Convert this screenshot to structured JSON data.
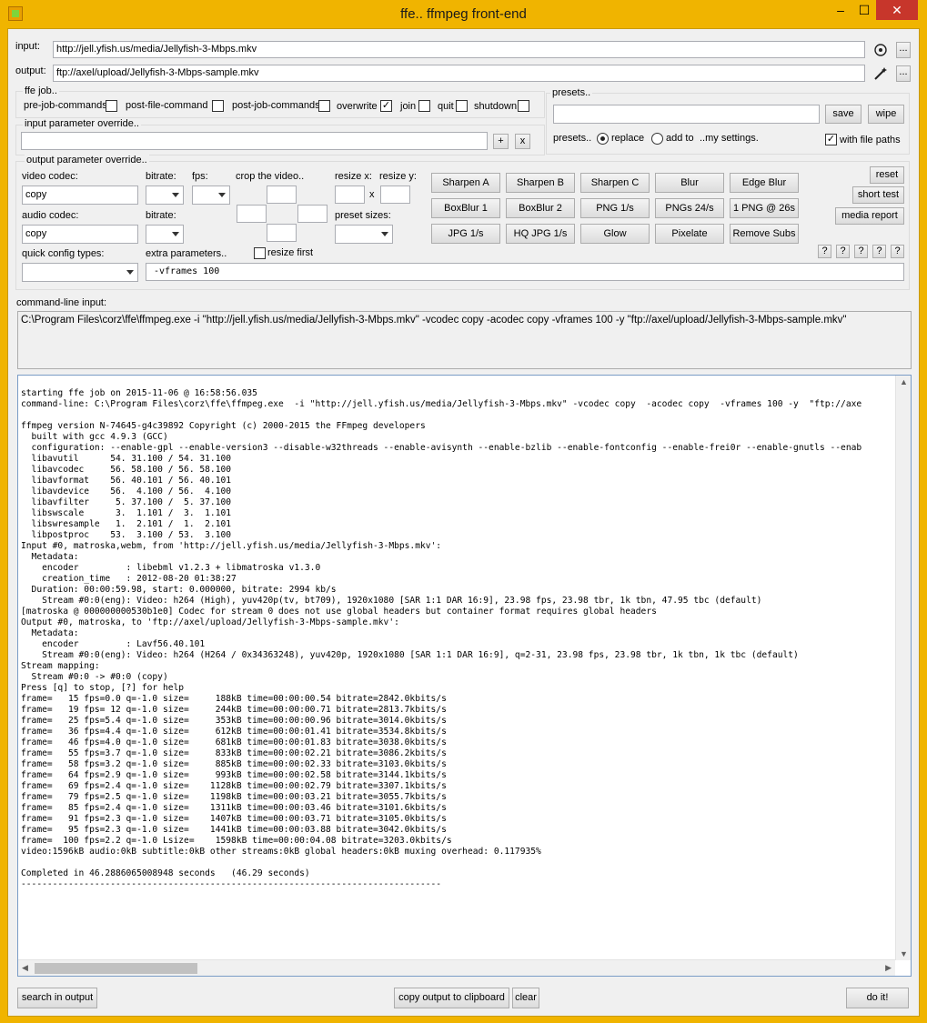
{
  "window": {
    "title": "ffe.. ffmpeg front-end",
    "minimize": "–",
    "maximize": "☐",
    "close": "✕"
  },
  "io": {
    "input_label": "input:",
    "input_value": "http://jell.yfish.us/media/Jellyfish-3-Mbps.mkv",
    "output_label": "output:",
    "output_value": "ftp://axel/upload/Jellyfish-3-Mbps-sample.mkv",
    "browse_label": "...",
    "target_icon": "crosshair-icon",
    "wand_icon": "magic-wand-icon"
  },
  "job": {
    "title": "ffe job..",
    "pre_job": "pre-job-commands",
    "post_file": "post-file-command",
    "post_job": "post-job-commands",
    "overwrite": "overwrite",
    "overwrite_checked": true,
    "join": "join",
    "quit": "quit",
    "shutdown": "shutdown"
  },
  "input_override": {
    "title": "input parameter override..",
    "value": "",
    "add": "+",
    "clear": "x"
  },
  "presets": {
    "title": "presets..",
    "selected": "",
    "save": "save",
    "wipe": "wipe",
    "mode_label": "presets..",
    "replace": "replace",
    "add_to": "add to",
    "my_settings": "..my settings.",
    "with_file_paths": "with file paths",
    "with_file_paths_checked": true
  },
  "output_override": {
    "title": "output parameter override..",
    "video_codec_label": "video codec:",
    "video_codec": "copy",
    "bitrate_label": "bitrate:",
    "fps_label": "fps:",
    "crop_label": "crop the video..",
    "resize_x_label": "resize x:",
    "resize_y_label": "resize y:",
    "resize_sep": "x",
    "audio_codec_label": "audio codec:",
    "audio_codec": "copy",
    "audio_bitrate_label": "bitrate:",
    "preset_sizes_label": "preset sizes:",
    "quick_config_label": "quick config types:",
    "extra_params_label": "extra parameters..",
    "resize_first": "resize first",
    "extra_params": "-vframes 100"
  },
  "filters": {
    "row1": [
      "Sharpen A",
      "Sharpen B",
      "Sharpen C",
      "Blur",
      "Edge Blur"
    ],
    "row2": [
      "BoxBlur 1",
      "BoxBlur 2",
      "PNG 1/s",
      "PNGs 24/s",
      "1 PNG @ 26s"
    ],
    "row3": [
      "JPG 1/s",
      "HQ JPG 1/s",
      "Glow",
      "Pixelate",
      "Remove Subs"
    ]
  },
  "side": {
    "reset": "reset",
    "short_test": "short test",
    "media_report": "media report",
    "help": "?"
  },
  "cmd": {
    "label": "command-line input:",
    "value": "C:\\Program Files\\corz\\ffe\\ffmpeg.exe  -i \"http://jell.yfish.us/media/Jellyfish-3-Mbps.mkv\" -vcodec copy  -acodec copy  -vframes 100 -y  \"ftp://axel/upload/Jellyfish-3-Mbps-sample.mkv\""
  },
  "output_log": [
    "starting ffe job on 2015-11-06 @ 16:58:56.035",
    "command-line: C:\\Program Files\\corz\\ffe\\ffmpeg.exe  -i \"http://jell.yfish.us/media/Jellyfish-3-Mbps.mkv\" -vcodec copy  -acodec copy  -vframes 100 -y  \"ftp://axe",
    "",
    "ffmpeg version N-74645-g4c39892 Copyright (c) 2000-2015 the FFmpeg developers",
    "  built with gcc 4.9.3 (GCC)",
    "  configuration: --enable-gpl --enable-version3 --disable-w32threads --enable-avisynth --enable-bzlib --enable-fontconfig --enable-frei0r --enable-gnutls --enab",
    "  libavutil      54. 31.100 / 54. 31.100",
    "  libavcodec     56. 58.100 / 56. 58.100",
    "  libavformat    56. 40.101 / 56. 40.101",
    "  libavdevice    56.  4.100 / 56.  4.100",
    "  libavfilter     5. 37.100 /  5. 37.100",
    "  libswscale      3.  1.101 /  3.  1.101",
    "  libswresample   1.  2.101 /  1.  2.101",
    "  libpostproc    53.  3.100 / 53.  3.100",
    "Input #0, matroska,webm, from 'http://jell.yfish.us/media/Jellyfish-3-Mbps.mkv':",
    "  Metadata:",
    "    encoder         : libebml v1.2.3 + libmatroska v1.3.0",
    "    creation_time   : 2012-08-20 01:38:27",
    "  Duration: 00:00:59.98, start: 0.000000, bitrate: 2994 kb/s",
    "    Stream #0:0(eng): Video: h264 (High), yuv420p(tv, bt709), 1920x1080 [SAR 1:1 DAR 16:9], 23.98 fps, 23.98 tbr, 1k tbn, 47.95 tbc (default)",
    "[matroska @ 000000000530b1e0] Codec for stream 0 does not use global headers but container format requires global headers",
    "Output #0, matroska, to 'ftp://axel/upload/Jellyfish-3-Mbps-sample.mkv':",
    "  Metadata:",
    "    encoder         : Lavf56.40.101",
    "    Stream #0:0(eng): Video: h264 (H264 / 0x34363248), yuv420p, 1920x1080 [SAR 1:1 DAR 16:9], q=2-31, 23.98 fps, 23.98 tbr, 1k tbn, 1k tbc (default)",
    "Stream mapping:",
    "  Stream #0:0 -> #0:0 (copy)",
    "Press [q] to stop, [?] for help",
    "frame=   15 fps=0.0 q=-1.0 size=     188kB time=00:00:00.54 bitrate=2842.0kbits/s",
    "frame=   19 fps= 12 q=-1.0 size=     244kB time=00:00:00.71 bitrate=2813.7kbits/s",
    "frame=   25 fps=5.4 q=-1.0 size=     353kB time=00:00:00.96 bitrate=3014.0kbits/s",
    "frame=   36 fps=4.4 q=-1.0 size=     612kB time=00:00:01.41 bitrate=3534.8kbits/s",
    "frame=   46 fps=4.0 q=-1.0 size=     681kB time=00:00:01.83 bitrate=3038.0kbits/s",
    "frame=   55 fps=3.7 q=-1.0 size=     833kB time=00:00:02.21 bitrate=3086.2kbits/s",
    "frame=   58 fps=3.2 q=-1.0 size=     885kB time=00:00:02.33 bitrate=3103.0kbits/s",
    "frame=   64 fps=2.9 q=-1.0 size=     993kB time=00:00:02.58 bitrate=3144.1kbits/s",
    "frame=   69 fps=2.4 q=-1.0 size=    1128kB time=00:00:02.79 bitrate=3307.1kbits/s",
    "frame=   79 fps=2.5 q=-1.0 size=    1198kB time=00:00:03.21 bitrate=3055.7kbits/s",
    "frame=   85 fps=2.4 q=-1.0 size=    1311kB time=00:00:03.46 bitrate=3101.6kbits/s",
    "frame=   91 fps=2.3 q=-1.0 size=    1407kB time=00:00:03.71 bitrate=3105.0kbits/s",
    "frame=   95 fps=2.3 q=-1.0 size=    1441kB time=00:00:03.88 bitrate=3042.0kbits/s",
    "frame=  100 fps=2.2 q=-1.0 Lsize=    1598kB time=00:00:04.08 bitrate=3203.0kbits/s",
    "video:1596kB audio:0kB subtitle:0kB other streams:0kB global headers:0kB muxing overhead: 0.117935%",
    "",
    "Completed in 46.2886065008948 seconds   (46.29 seconds)",
    "--------------------------------------------------------------------------------"
  ],
  "bottom": {
    "search": "search in output",
    "copy": "copy output to clipboard",
    "clear": "clear",
    "do_it": "do it!"
  }
}
